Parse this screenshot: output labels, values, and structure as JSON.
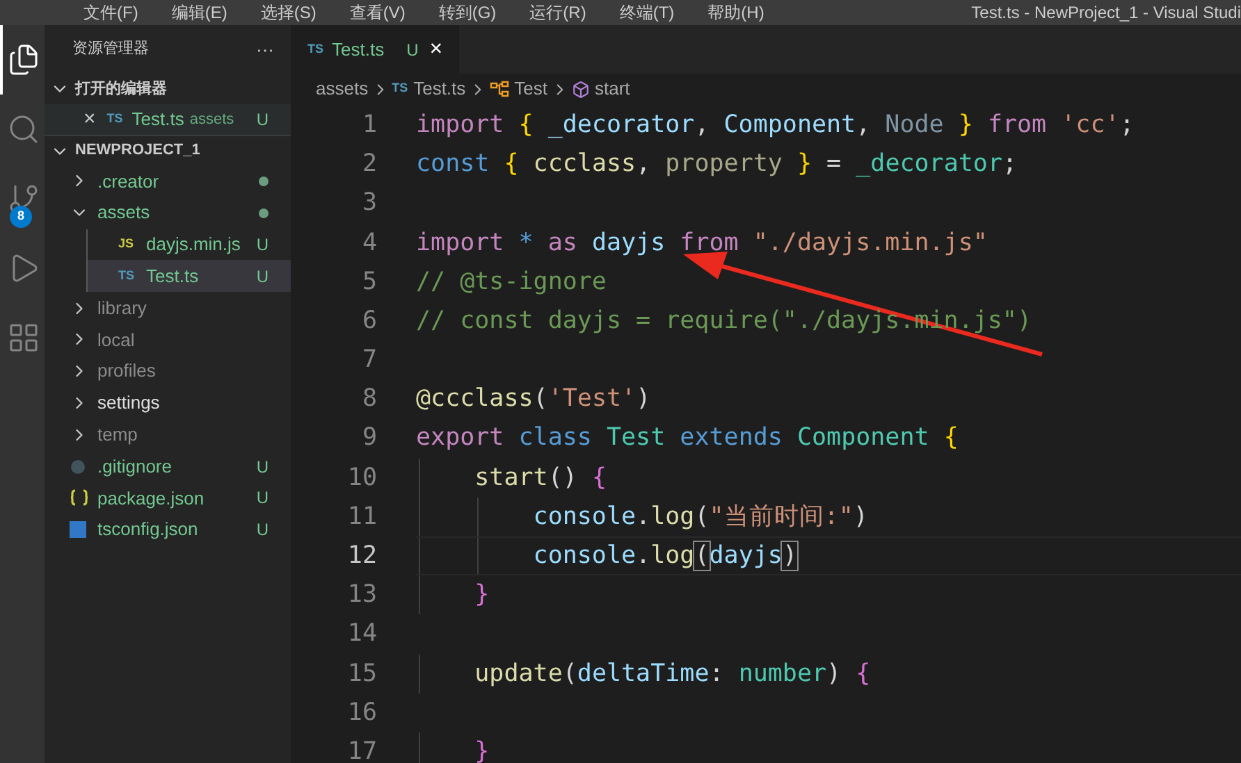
{
  "menu_bar": {
    "items": [
      "文件(F)",
      "编辑(E)",
      "选择(S)",
      "查看(V)",
      "转到(G)",
      "运行(R)",
      "终端(T)",
      "帮助(H)"
    ],
    "window_title": "Test.ts - NewProject_1 - Visual Studi"
  },
  "activity_bar": [
    {
      "kind": "files",
      "selected": true
    },
    {
      "kind": "search",
      "selected": false
    },
    {
      "kind": "source-control",
      "selected": false,
      "badge": "8"
    },
    {
      "kind": "run",
      "selected": false
    },
    {
      "kind": "extensions",
      "selected": false
    }
  ],
  "sidebar": {
    "title": "资源管理器",
    "more": "···",
    "open_editors": {
      "title": "打开的编辑器",
      "expanded": true,
      "items": [
        {
          "close": "×",
          "icon": "TS",
          "name": "Test.ts",
          "folder": "assets",
          "badge": "U"
        }
      ]
    },
    "project": {
      "title": "NEWPROJECT_1",
      "expanded": true,
      "items": [
        {
          "name": ".creator",
          "kind": "folder",
          "expanded": false,
          "color": "#73c991",
          "modified": true,
          "selected": false
        },
        {
          "name": "assets",
          "kind": "folder",
          "expanded": true,
          "color": "#73c991",
          "modified": true,
          "selected": false,
          "children": [
            {
              "name": "dayjs.min.js",
              "kind": "js",
              "icon": "JS",
              "color": "#73c991",
              "badge": "U",
              "selected": false
            },
            {
              "name": "Test.ts",
              "kind": "ts",
              "icon": "TS",
              "color": "#73c991",
              "badge": "U",
              "selected": true
            }
          ]
        },
        {
          "name": "library",
          "kind": "folder",
          "expanded": false,
          "color": "#8c8c8c",
          "modified": false,
          "selected": false
        },
        {
          "name": "local",
          "kind": "folder",
          "expanded": false,
          "color": "#8c8c8c",
          "modified": false,
          "selected": false
        },
        {
          "name": "profiles",
          "kind": "folder",
          "expanded": false,
          "color": "#8c8c8c",
          "modified": false,
          "selected": false
        },
        {
          "name": "settings",
          "kind": "folder",
          "expanded": false,
          "color": "#e0e0e0",
          "modified": false,
          "selected": false
        },
        {
          "name": "temp",
          "kind": "folder",
          "expanded": false,
          "color": "#8c8c8c",
          "modified": false,
          "selected": false
        },
        {
          "name": ".gitignore",
          "kind": "git",
          "color": "#73c991",
          "badge": "U",
          "selected": false
        },
        {
          "name": "package.json",
          "kind": "json",
          "color": "#73c991",
          "badge": "U",
          "selected": false
        },
        {
          "name": "tsconfig.json",
          "kind": "tsconfig",
          "color": "#73c991",
          "badge": "U",
          "selected": false
        }
      ]
    }
  },
  "tabs": [
    {
      "icon": "TS",
      "label": "Test.ts",
      "badge": "U",
      "close": "×",
      "selected": true
    }
  ],
  "breadcrumb": [
    {
      "kind": "folder",
      "text": "assets"
    },
    {
      "kind": "ts",
      "icon": "TS",
      "text": "Test.ts"
    },
    {
      "kind": "class",
      "text": "Test"
    },
    {
      "kind": "method",
      "text": "start"
    }
  ],
  "code": [
    {
      "number": "1",
      "current": false,
      "tokens": [
        {
          "text": "import",
          "kind": "keyword"
        },
        {
          "text": " { ",
          "kind": "brace"
        },
        {
          "text": "_decorator",
          "kind": "variable"
        },
        {
          "text": ", ",
          "kind": "plain"
        },
        {
          "text": "Component",
          "kind": "variable"
        },
        {
          "text": ", ",
          "kind": "plain"
        },
        {
          "text": "Node",
          "kind": "unused"
        },
        {
          "text": " }",
          "kind": "brace"
        },
        {
          "text": " from ",
          "kind": "keyword"
        },
        {
          "text": "'cc'",
          "kind": "string"
        },
        {
          "text": ";",
          "kind": "plain"
        }
      ]
    },
    {
      "number": "2",
      "current": false,
      "tokens": [
        {
          "text": "const",
          "kind": "storage"
        },
        {
          "text": " { ",
          "kind": "brace"
        },
        {
          "text": "ccclass",
          "kind": "function"
        },
        {
          "text": ", ",
          "kind": "plain"
        },
        {
          "text": "property",
          "kind": "unused2"
        },
        {
          "text": " }",
          "kind": "brace"
        },
        {
          "text": " = ",
          "kind": "plain"
        },
        {
          "text": "_decorator",
          "kind": "type"
        },
        {
          "text": ";",
          "kind": "plain"
        }
      ]
    },
    {
      "number": "3",
      "current": false
    },
    {
      "number": "4",
      "current": false,
      "tokens": [
        {
          "text": "import",
          "kind": "keyword"
        },
        {
          "text": " * ",
          "kind": "storage"
        },
        {
          "text": "as",
          "kind": "keyword"
        },
        {
          "text": " dayjs",
          "kind": "variable"
        },
        {
          "text": " from ",
          "kind": "keyword"
        },
        {
          "text": "\"./dayjs.min.js\"",
          "kind": "string"
        }
      ]
    },
    {
      "number": "5",
      "current": false,
      "tokens": [
        {
          "text": "// @ts-ignore",
          "kind": "comment"
        }
      ]
    },
    {
      "number": "6",
      "current": false,
      "tokens": [
        {
          "text": "// const dayjs = require(\"./dayjs.min.js\")",
          "kind": "comment"
        }
      ]
    },
    {
      "number": "7",
      "current": false
    },
    {
      "number": "8",
      "current": false,
      "tokens": [
        {
          "text": "@ccclass",
          "kind": "function"
        },
        {
          "text": "(",
          "kind": "plain"
        },
        {
          "text": "'Test'",
          "kind": "string"
        },
        {
          "text": ")",
          "kind": "plain"
        }
      ]
    },
    {
      "number": "9",
      "current": false,
      "tokens": [
        {
          "text": "export",
          "kind": "keyword"
        },
        {
          "text": " class ",
          "kind": "storage"
        },
        {
          "text": "Test",
          "kind": "type"
        },
        {
          "text": " extends ",
          "kind": "storage"
        },
        {
          "text": "Component",
          "kind": "type"
        },
        {
          "text": " {",
          "kind": "brace"
        }
      ]
    },
    {
      "number": "10",
      "current": false,
      "tokens": [
        {
          "text": "    start",
          "kind": "function"
        },
        {
          "text": "() ",
          "kind": "plain"
        },
        {
          "text": "{",
          "kind": "brace2"
        }
      ]
    },
    {
      "number": "11",
      "current": false,
      "tokens": [
        {
          "text": "        console",
          "kind": "variable"
        },
        {
          "text": ".",
          "kind": "plain"
        },
        {
          "text": "log",
          "kind": "function"
        },
        {
          "text": "(",
          "kind": "plain"
        },
        {
          "text": "\"当前时间:\"",
          "kind": "string"
        },
        {
          "text": ")",
          "kind": "plain"
        }
      ]
    },
    {
      "number": "12",
      "current": true,
      "tokens": [
        {
          "text": "        console",
          "kind": "variable"
        },
        {
          "text": ".",
          "kind": "plain"
        },
        {
          "text": "log",
          "kind": "function"
        },
        {
          "text": "(",
          "kind": "bracket-match"
        },
        {
          "text": "dayjs",
          "kind": "variable"
        },
        {
          "text": ")",
          "kind": "bracket-match"
        }
      ]
    },
    {
      "number": "13",
      "current": false,
      "tokens": [
        {
          "text": "    }",
          "kind": "brace2"
        }
      ]
    },
    {
      "number": "14",
      "current": false
    },
    {
      "number": "15",
      "current": false,
      "tokens": [
        {
          "text": "    update",
          "kind": "function"
        },
        {
          "text": "(",
          "kind": "plain"
        },
        {
          "text": "deltaTime",
          "kind": "variable"
        },
        {
          "text": ": ",
          "kind": "plain"
        },
        {
          "text": "number",
          "kind": "type"
        },
        {
          "text": ") ",
          "kind": "plain"
        },
        {
          "text": "{",
          "kind": "brace2"
        }
      ]
    },
    {
      "number": "16",
      "current": false
    },
    {
      "number": "17",
      "current": false,
      "tokens": [
        {
          "text": "    }",
          "kind": "brace2"
        }
      ]
    }
  ]
}
